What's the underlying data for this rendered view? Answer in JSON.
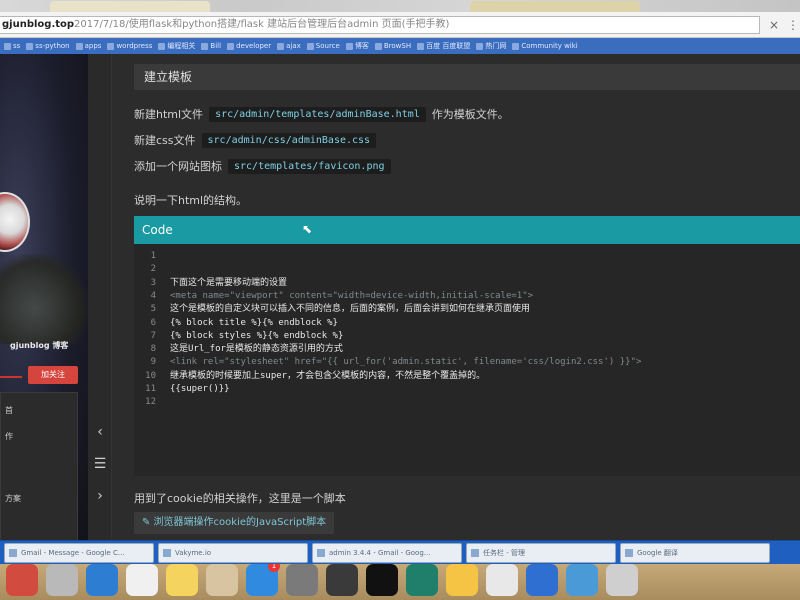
{
  "browser": {
    "url_host": "gjunblog.top",
    "url_rest": "2017/7/18/使用flask和python搭建/flask 建站后台管理后台admin 页面(手把手教)",
    "close_tab_glyph": "×",
    "menu_glyph": "⋮"
  },
  "bookmarks": [
    "ss",
    "ss-python",
    "apps",
    "wordpress",
    "编程相关",
    "Bill",
    "developer",
    "ajax",
    "Source",
    "博客",
    "BrowSH",
    "百度 百度联盟",
    "热门网",
    "Community wiki"
  ],
  "sidebar": {
    "blog_name": "gjunblog 博客",
    "follow_label": "加关注",
    "menu_items": [
      "首",
      "作",
      "方案"
    ]
  },
  "toc": {
    "prev_glyph": "‹",
    "menu_glyph": "☰",
    "next_glyph": "›"
  },
  "content": {
    "section_heading": "建立模板",
    "paragraphs": [
      {
        "text": "新建html文件",
        "code": "src/admin/templates/adminBase.html",
        "suffix": "作为模板文件。"
      },
      {
        "text": "新建css文件",
        "code": "src/admin/css/adminBase.css",
        "suffix": ""
      },
      {
        "text": "添加一个网站图标",
        "code": "src/templates/favicon.png",
        "suffix": ""
      }
    ],
    "intro": "说明一下html的结构。",
    "code_header": "Code",
    "code_lines": [
      {
        "n": "1",
        "text": "",
        "style": "plain"
      },
      {
        "n": "2",
        "text": "",
        "style": "plain"
      },
      {
        "n": "3",
        "text": "下面这个是需要移动端的设置",
        "style": "plain"
      },
      {
        "n": "4",
        "text": "<meta name=\"viewport\" content=\"width=device-width,initial-scale=1\">",
        "style": "dim"
      },
      {
        "n": "5",
        "text": "这个是模板的自定义块可以插入不同的信息，后面的案例，后面会讲到如何在继承页面使用",
        "style": "plain"
      },
      {
        "n": "6",
        "text": "{% block title %}{% endblock %}",
        "style": "plain"
      },
      {
        "n": "7",
        "text": "{% block styles %}{% endblock %}",
        "style": "plain"
      },
      {
        "n": "8",
        "text": "这是Url_for是模板的静态资源引用的方式",
        "style": "plain"
      },
      {
        "n": "9",
        "text": "<link rel=\"stylesheet\" href=\"{{ url_for('admin.static', filename='css/login2.css') }}\">",
        "style": "dim"
      },
      {
        "n": "10",
        "text": "继承模板的时候要加上super，才会包含父模板的内容，不然是整个覆盖掉的。",
        "style": "plain"
      },
      {
        "n": "11",
        "text": "{{super()}}",
        "style": "plain"
      },
      {
        "n": "12",
        "text": "",
        "style": "plain"
      }
    ],
    "cookie_para": "用到了cookie的相关操作，这里是一个脚本",
    "cookie_link": "✎ 浏览器端操作cookie的JavaScript脚本"
  },
  "taskbar": [
    "Gmail - Message - Google C...",
    "Vakyme.io",
    "admin 3.4.4 - Gmail - Goog...",
    "任务栏 - 管理",
    "Google 翻译"
  ],
  "dock": [
    {
      "name": "finder",
      "color": "#d24b3f"
    },
    {
      "name": "launchpad",
      "color": "#b9b9b9"
    },
    {
      "name": "safari",
      "color": "#2d7dd2"
    },
    {
      "name": "calendar",
      "color": "#f0f0f0"
    },
    {
      "name": "notes",
      "color": "#f4d35e"
    },
    {
      "name": "contacts",
      "color": "#d9c4a2"
    },
    {
      "name": "appstore",
      "color": "#2f8ae0",
      "badge": "1"
    },
    {
      "name": "system-preferences",
      "color": "#7a7a7a"
    },
    {
      "name": "calculator",
      "color": "#3a3a3a"
    },
    {
      "name": "terminal",
      "color": "#111111"
    },
    {
      "name": "pycharm",
      "color": "#1f7f6a"
    },
    {
      "name": "qq",
      "color": "#f5c445"
    },
    {
      "name": "chrome",
      "color": "#e8e8e8"
    },
    {
      "name": "xcode",
      "color": "#2f6fd1"
    },
    {
      "name": "finder-2",
      "color": "#4a9ad8"
    },
    {
      "name": "trash",
      "color": "#cfcfcf"
    }
  ]
}
